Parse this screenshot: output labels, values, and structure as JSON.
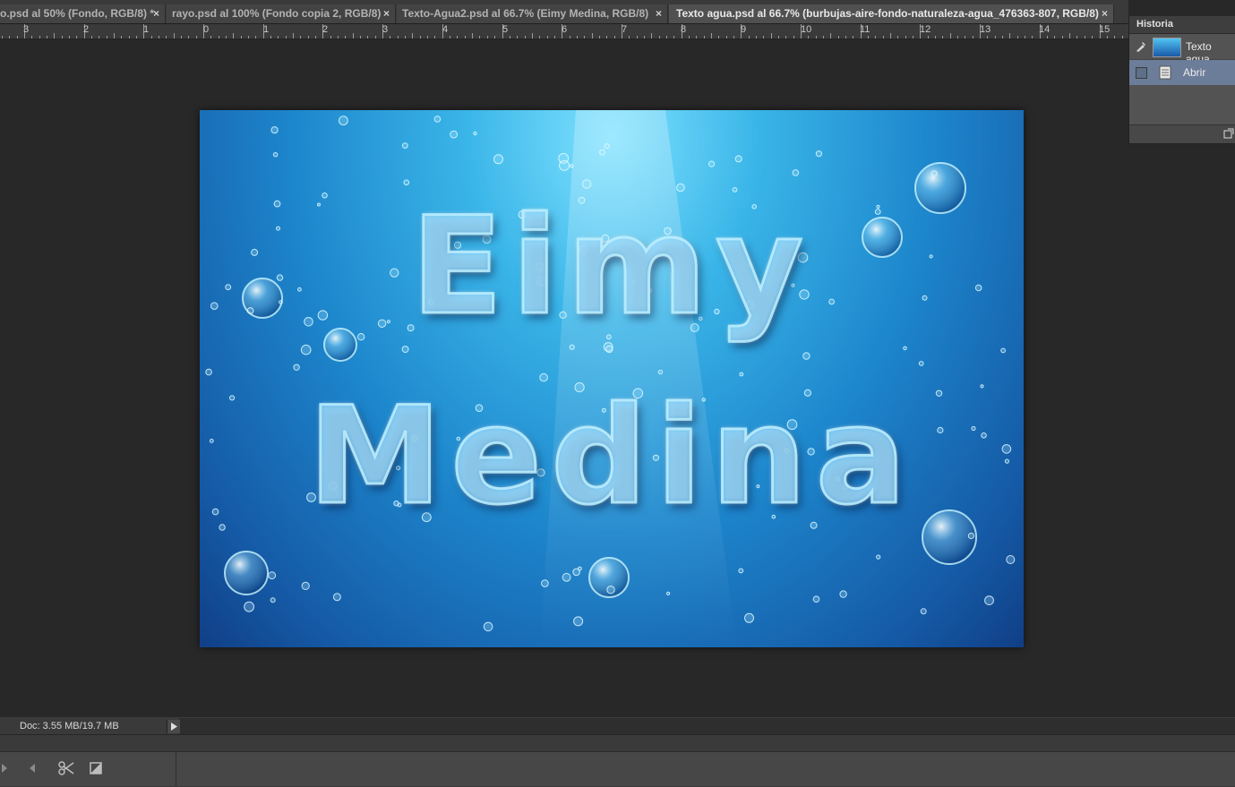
{
  "tabs": [
    {
      "label": "o.psd al 50% (Fondo, RGB/8) *",
      "close": "×",
      "active": false
    },
    {
      "label": "rayo.psd al 100% (Fondo copia 2, RGB/8)",
      "close": "×",
      "active": false
    },
    {
      "label": "Texto-Agua2.psd al 66.7% (Eimy Medina, RGB/8)",
      "close": "×",
      "active": false
    },
    {
      "label": "Texto agua.psd al 66.7% (burbujas-aire-fondo-naturaleza-agua_476363-807, RGB/8)",
      "close": "×",
      "active": true
    }
  ],
  "ruler": {
    "labels": [
      "3",
      "2",
      "1",
      "0",
      "1",
      "2",
      "3",
      "4",
      "5",
      "6",
      "7",
      "8",
      "9",
      "10",
      "11",
      "12",
      "13",
      "14",
      "15"
    ]
  },
  "canvas": {
    "line1": "Eimy",
    "line2": "Medina"
  },
  "history": {
    "title": "Historia",
    "snapshot_label": "Texto agua",
    "state_label": "Abrir"
  },
  "status": {
    "doc": "Doc: 3.55 MB/19.7 MB"
  },
  "icons": {
    "brush": "history-brush-icon",
    "document": "document-icon",
    "new": "new-snapshot-icon",
    "prev": "previous-frame-icon",
    "cut": "scissors-icon",
    "transition": "transition-icon"
  }
}
